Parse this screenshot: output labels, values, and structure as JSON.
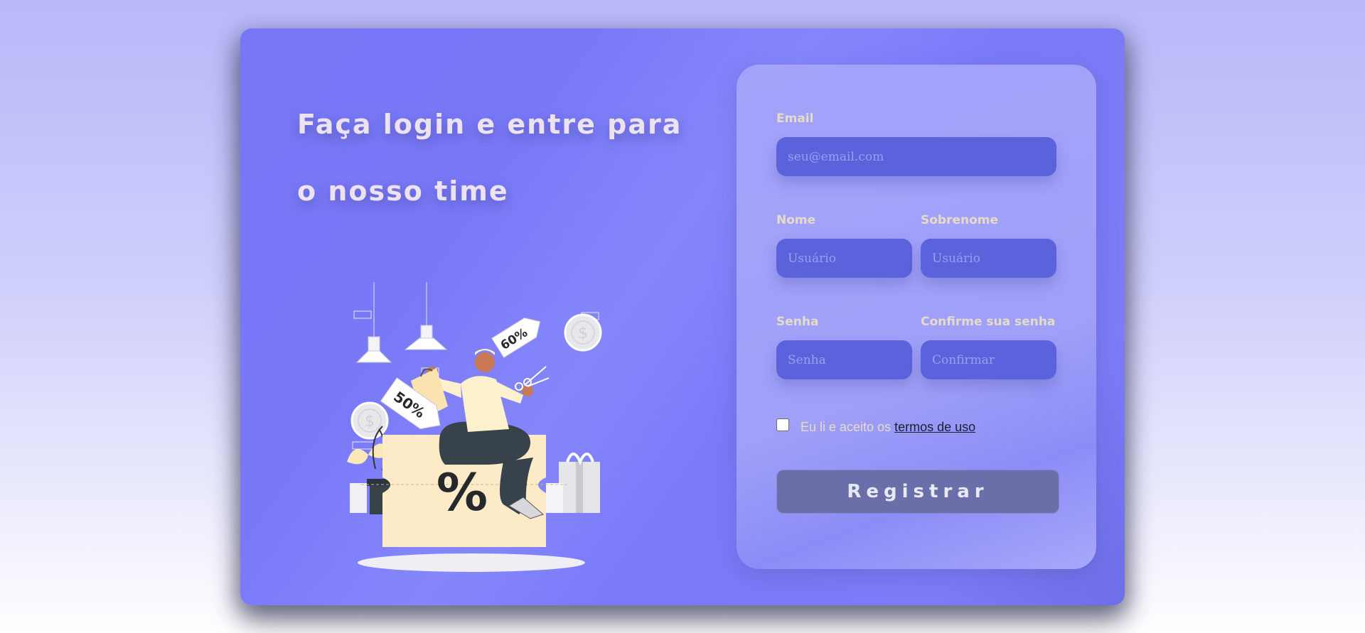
{
  "hero": {
    "headline": "Faça login e entre para o nosso time",
    "illustration": {
      "tag_left": "50%",
      "tag_right": "60%",
      "box_symbol": "%",
      "coin_symbol": "$"
    }
  },
  "form": {
    "email": {
      "label": "Email",
      "placeholder": "seu@email.com",
      "value": ""
    },
    "first_name": {
      "label": "Nome",
      "placeholder": "Usuário",
      "value": ""
    },
    "last_name": {
      "label": "Sobrenome",
      "placeholder": "Usuário",
      "value": ""
    },
    "password": {
      "label": "Senha",
      "placeholder": "Senha",
      "value": ""
    },
    "confirm": {
      "label": "Confirme sua senha",
      "placeholder": "Confirmar",
      "value": ""
    },
    "terms": {
      "prefix": "Eu li e aceito os",
      "link": "termos de uso",
      "checked": false
    },
    "submit_label": "Registrar"
  },
  "colors": {
    "card": "#7878f7",
    "panel": "#a3a3fa",
    "input": "#5b63dc",
    "button": "#6b6fa9",
    "label": "#e4dcc8"
  }
}
